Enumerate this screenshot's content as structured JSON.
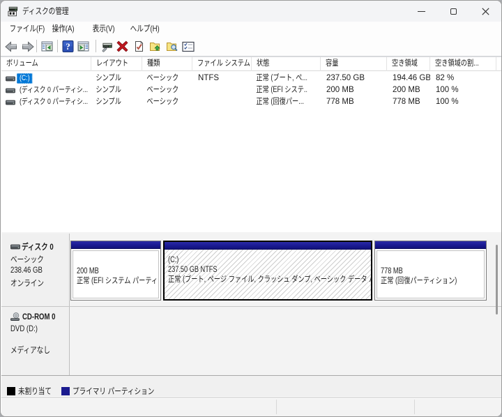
{
  "window": {
    "title": "ディスクの管理"
  },
  "titlebar": {
    "icons": [
      "disk-management-app-icon"
    ],
    "buttons": [
      "minimize",
      "maximize",
      "close"
    ]
  },
  "menu": {
    "items": [
      {
        "label": "ファイル(F)"
      },
      {
        "label": "操作(A)"
      },
      {
        "label": "表示(V)"
      },
      {
        "label": "ヘルプ(H)"
      }
    ]
  },
  "toolbar": {
    "icons": [
      "back",
      "forward",
      "show-console-tree",
      "help",
      "show-action-pane",
      "rescan-disks",
      "delete-volume",
      "check-volume",
      "open-folder",
      "explore-folder",
      "options-list"
    ]
  },
  "volume_list": {
    "columns": [
      "ボリューム",
      "レイアウト",
      "種類",
      "ファイル システム",
      "状態",
      "容量",
      "空き領域",
      "空き領域の割..."
    ],
    "rows": [
      {
        "volume": "(C:)",
        "layout": "シンプル",
        "type": "ベーシック",
        "fs": "NTFS",
        "status": "正常 (ブート, ペ...",
        "capacity": "237.50 GB",
        "free": "194.46 GB",
        "free_pct": "82 %",
        "selected": true
      },
      {
        "volume": "(ディスク 0 パーティシ...",
        "layout": "シンプル",
        "type": "ベーシック",
        "fs": "",
        "status": "正常 (EFI システ...",
        "capacity": "200 MB",
        "free": "200 MB",
        "free_pct": "100 %",
        "selected": false
      },
      {
        "volume": "(ディスク 0 パーティシ...",
        "layout": "シンプル",
        "type": "ベーシック",
        "fs": "",
        "status": "正常 (回復パー...",
        "capacity": "778 MB",
        "free": "778 MB",
        "free_pct": "100 %",
        "selected": false
      }
    ]
  },
  "disks": [
    {
      "name": "ディスク 0",
      "kind": "ベーシック",
      "size": "238.46 GB",
      "state": "オンライン",
      "partitions": [
        {
          "line1": "",
          "line2": "200 MB",
          "line3": "正常 (EFI システム パーティション)",
          "selected": false
        },
        {
          "line1": "(C:)",
          "line2": "237.50 GB NTFS",
          "line3": "正常 (ブート, ページ ファイル, クラッシュ ダンプ, ベーシック データ パーティション)",
          "selected": true
        },
        {
          "line1": "",
          "line2": "778 MB",
          "line3": "正常 (回復パーティション)",
          "selected": false
        }
      ]
    },
    {
      "name": "CD-ROM 0",
      "kind": "DVD (D:)",
      "state": "メディアなし",
      "partitions": []
    }
  ],
  "legend": {
    "items": [
      {
        "label": "未割り当て",
        "color": "#000000"
      },
      {
        "label": "プライマリ パーティション",
        "color": "#1b1b8f"
      }
    ]
  },
  "colors": {
    "desktop": "#a9abae",
    "winborder": "#9b9b9b",
    "titlebar": "#f3f4f6",
    "chrome": "#fdfdfd",
    "panebg": "#f3f3f3",
    "labelbg": "#f0f0f0",
    "sel": "#0078d7",
    "text": "#1b1b1b",
    "primary_partition": "#1b1b8f",
    "unallocated": "#000000"
  }
}
